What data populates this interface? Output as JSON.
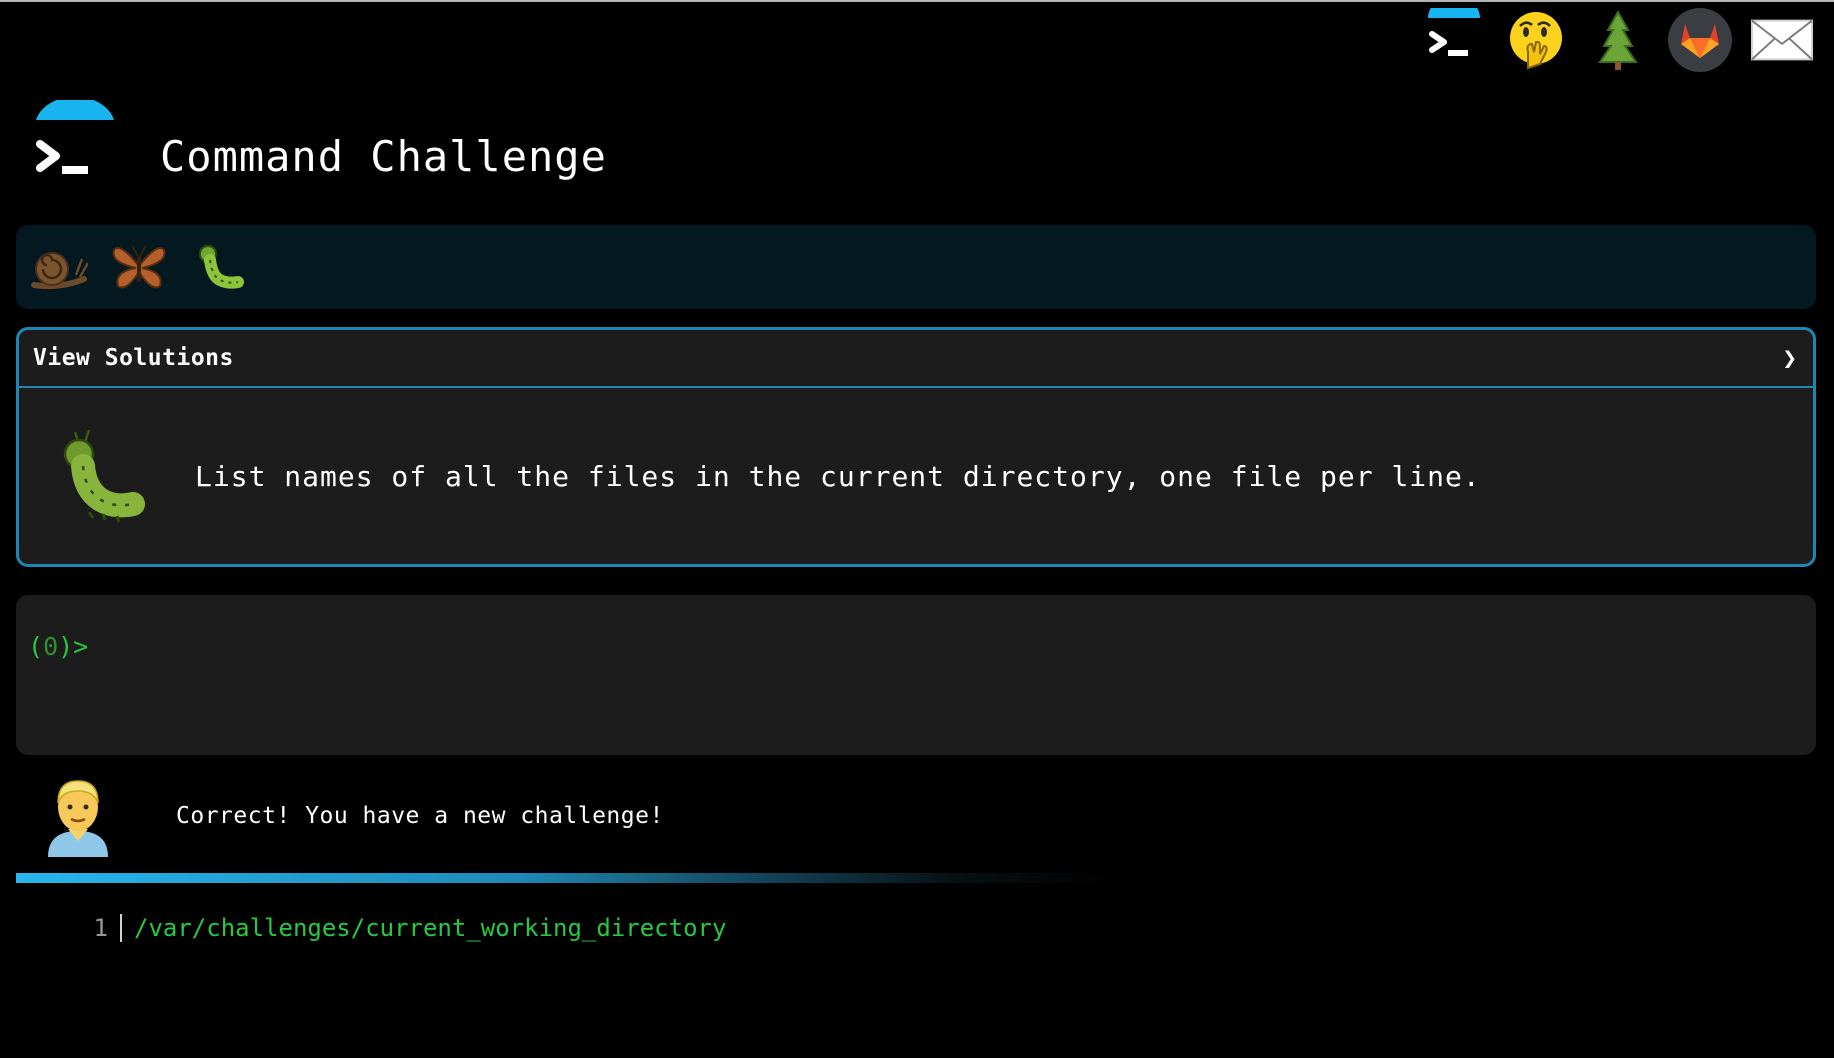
{
  "header": {
    "title": "Command Challenge"
  },
  "top_icons": [
    {
      "name": "terminal-logo-icon"
    },
    {
      "name": "hand-over-mouth-emoji-icon"
    },
    {
      "name": "tree-icon"
    },
    {
      "name": "gitlab-icon"
    },
    {
      "name": "envelope-icon"
    }
  ],
  "levels": [
    {
      "name": "snail-icon"
    },
    {
      "name": "butterfly-icon"
    },
    {
      "name": "caterpillar-icon"
    }
  ],
  "solutions": {
    "label": "View Solutions",
    "chevron": "❯",
    "description": "List names of all the files in the current directory, one file per line."
  },
  "terminal": {
    "prompt_open": "(",
    "prompt_count": "0",
    "prompt_close": ")>",
    "input_value": ""
  },
  "feedback": {
    "message": "Correct! You have a new challenge!"
  },
  "output": {
    "lines": [
      {
        "number": "1",
        "text": "/var/challenges/current_working_directory"
      }
    ]
  },
  "colors": {
    "accent": "#1f86b4",
    "prompt_green": "#27c93f",
    "panel_bg": "#1c1c1c",
    "strip_bg": "#041820"
  }
}
